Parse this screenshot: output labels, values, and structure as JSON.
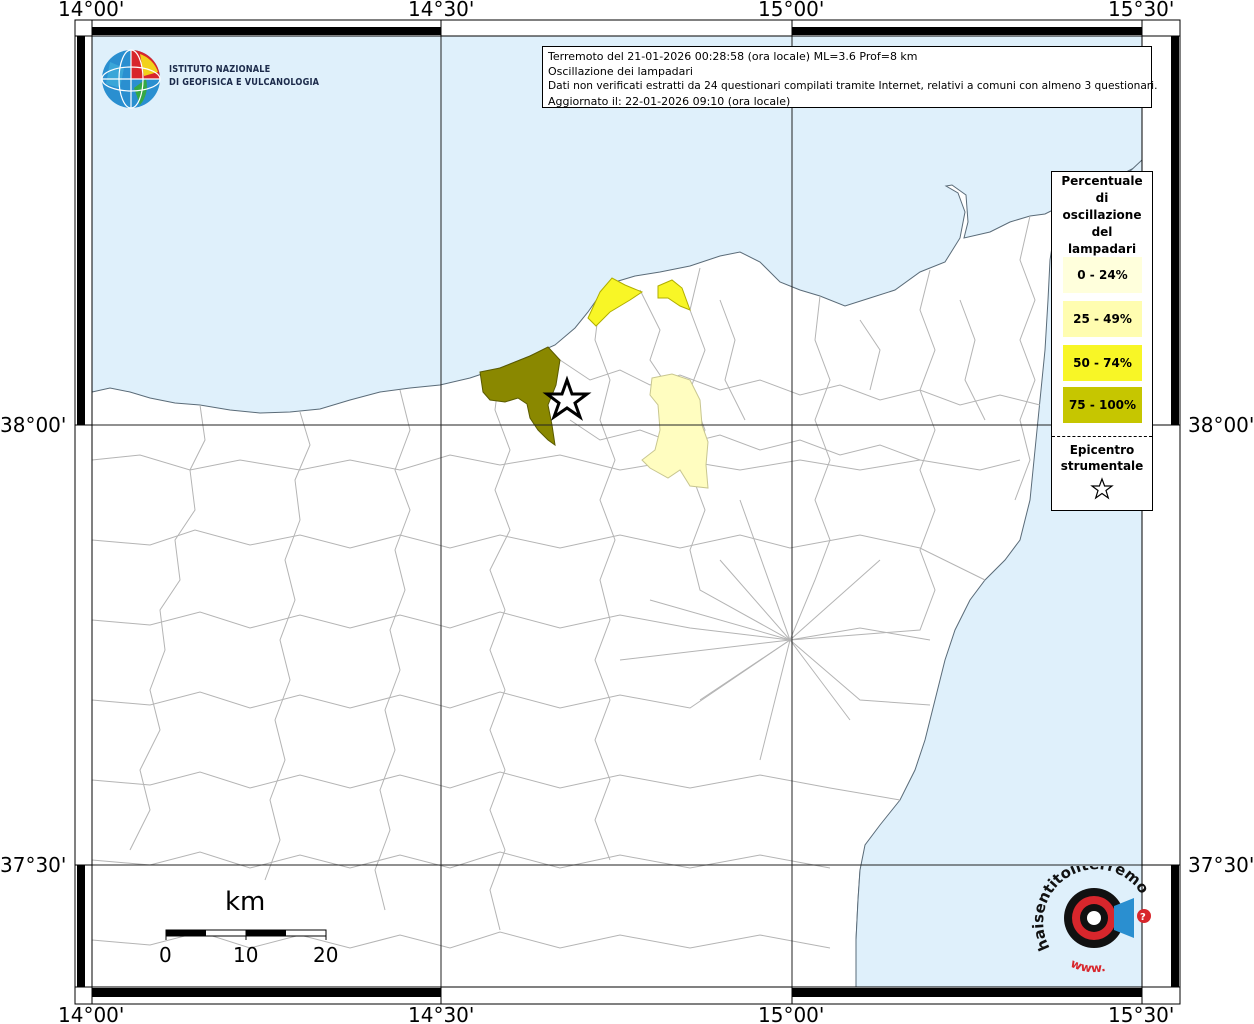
{
  "map": {
    "lon_labels": [
      "14°00'",
      "14°30'",
      "15°00'",
      "15°30'"
    ],
    "lat_labels": [
      "38°00'",
      "37°30'"
    ],
    "sea_color": "#dff0fb",
    "land_color": "#ffffff",
    "border_color": "#b4b4b4"
  },
  "info": {
    "line1": "Terremoto del 21-01-2026 00:28:58 (ora locale) ML=3.6 Prof=8 km",
    "line2": "Oscillazione dei lampadari",
    "line3": "Dati non verificati estratti da 24 questionari compilati tramite Internet, relativi a comuni con almeno 3 questionari.",
    "line4": "Aggiornato il: 22-01-2026 09:10 (ora locale)"
  },
  "logo": {
    "line1": "ISTITUTO NAZIONALE",
    "line2": "DI GEOFISICA E VULCANOLOGIA"
  },
  "legend": {
    "title_lines": [
      "Percentuale",
      "di",
      "oscillazione",
      "del",
      "lampadari"
    ],
    "classes": [
      {
        "label": "0 - 24%",
        "color": "#ffffdc"
      },
      {
        "label": "25 - 49%",
        "color": "#fffdb0"
      },
      {
        "label": "50 - 74%",
        "color": "#f8f626"
      },
      {
        "label": "75 - 100%",
        "color": "#c6c600"
      }
    ],
    "epicentre_lines": [
      "Epicentro",
      "strumentale"
    ]
  },
  "municipalities": [
    {
      "class_label": "75 - 100%",
      "color": "#8a8800"
    },
    {
      "class_label": "50 - 74%",
      "color": "#f8f626"
    },
    {
      "class_label": "50 - 74%",
      "color": "#f8f626"
    },
    {
      "class_label": "25 - 49%",
      "color": "#fffdc0"
    }
  ],
  "scale": {
    "unit": "km",
    "labels": [
      "0",
      "10",
      "20"
    ]
  },
  "hst_logo": {
    "text_top": "haisentitoilterremoto.it",
    "text_bottom": "www."
  }
}
